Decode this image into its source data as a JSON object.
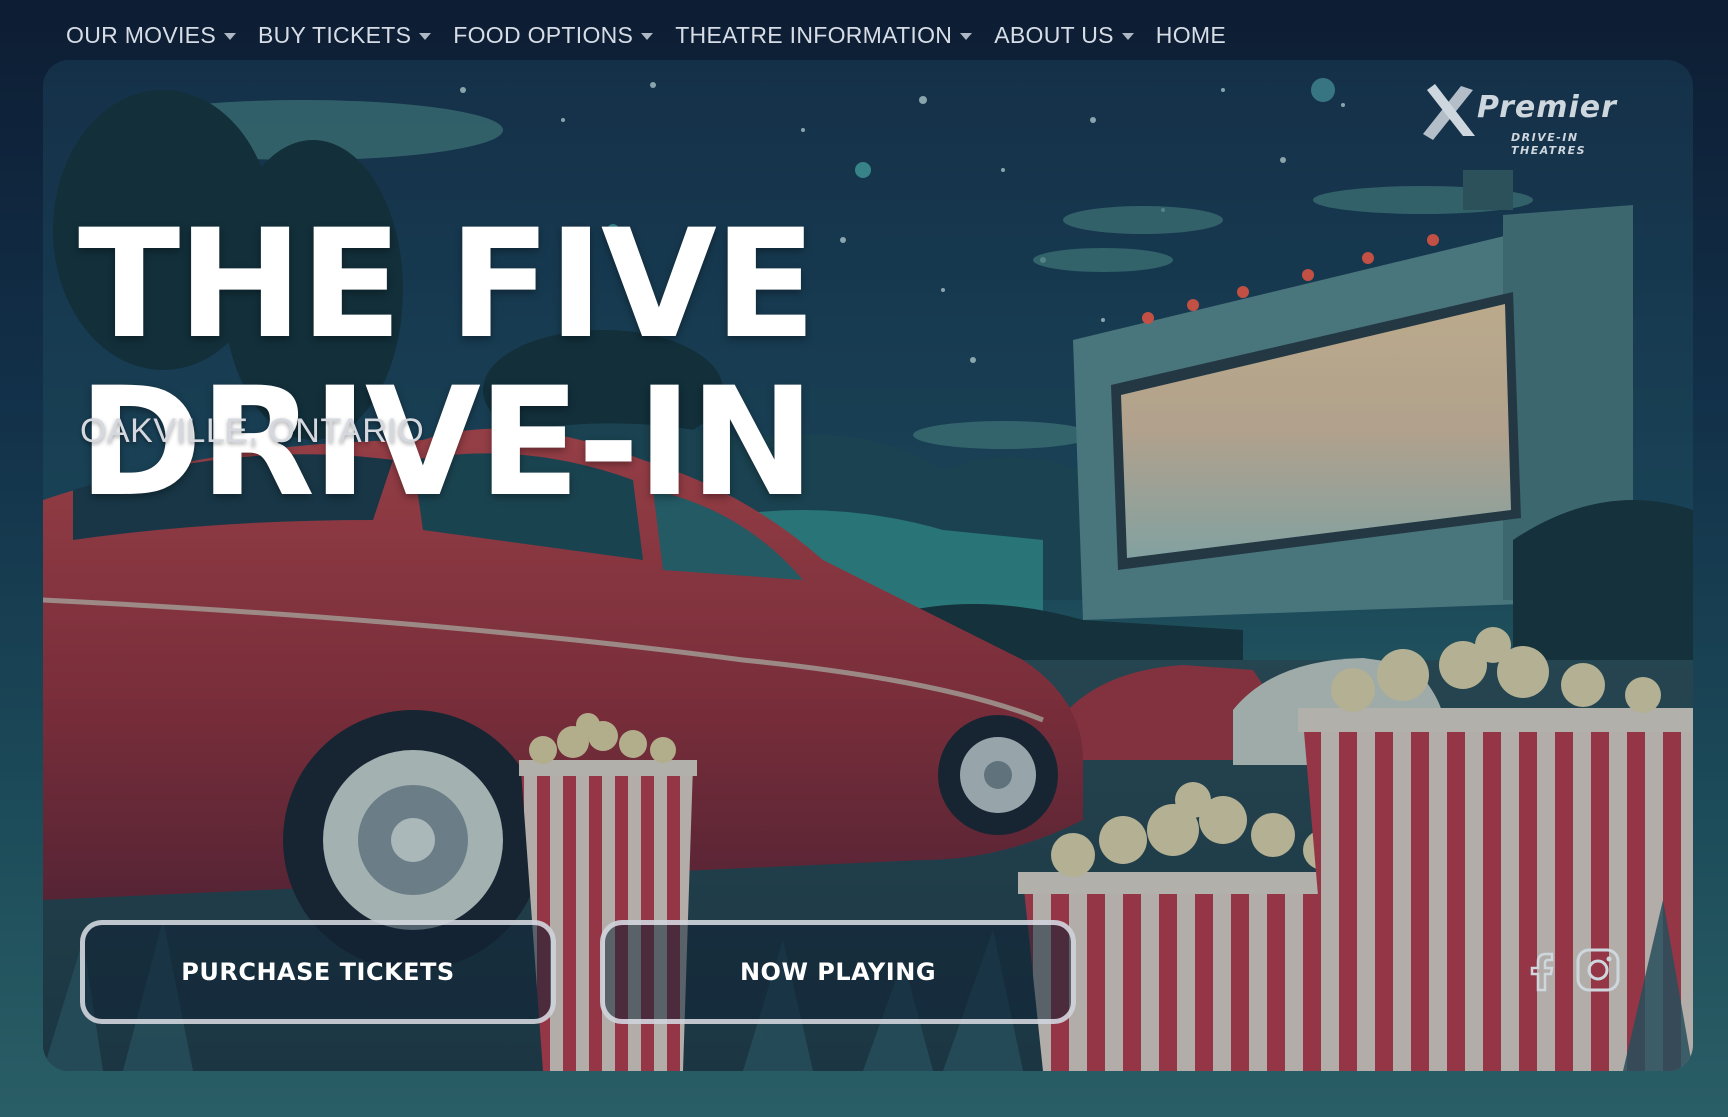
{
  "nav": {
    "items": [
      {
        "label": "OUR MOVIES",
        "dropdown": true
      },
      {
        "label": "BUY TICKETS",
        "dropdown": true
      },
      {
        "label": "FOOD OPTIONS",
        "dropdown": true
      },
      {
        "label": "THEATRE INFORMATION",
        "dropdown": true
      },
      {
        "label": "ABOUT US",
        "dropdown": true
      },
      {
        "label": "HOME",
        "dropdown": false
      }
    ]
  },
  "hero": {
    "title_line1": "THE FIVE",
    "title_line2": "DRIVE-IN",
    "location": "OAKVILLE, ONTARIO",
    "logo_name": "Premier",
    "logo_tagline": "DRIVE-IN THEATRES",
    "primary_cta": "PURCHASE TICKETS",
    "secondary_cta": "NOW PLAYING"
  },
  "social": {
    "facebook_icon": "facebook-icon",
    "instagram_icon": "instagram-icon"
  },
  "colors": {
    "nav_background": "#0d1d33",
    "nav_text": "#d7dde6",
    "title": "#ffffff",
    "car_red": "#a8333d",
    "screen_glow": "#f2d2a8"
  }
}
